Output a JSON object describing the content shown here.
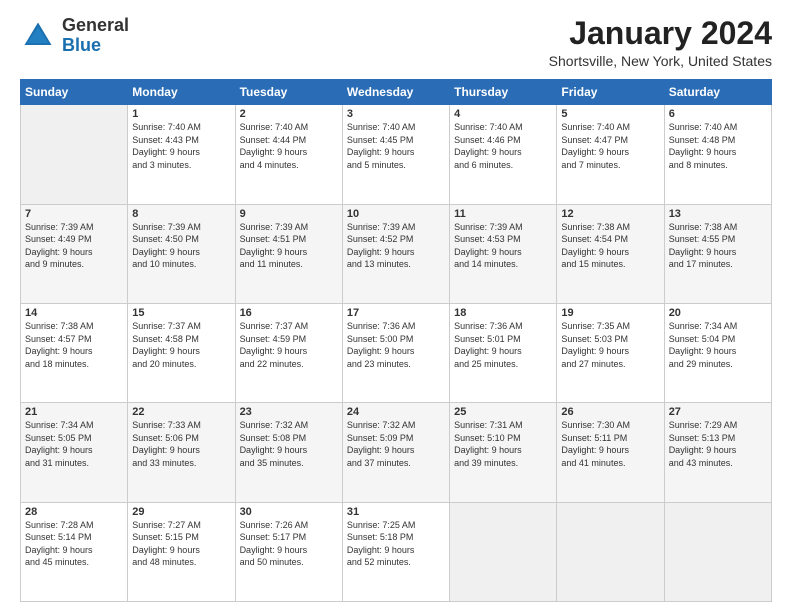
{
  "logo": {
    "line1": "General",
    "line2": "Blue"
  },
  "title": "January 2024",
  "subtitle": "Shortsville, New York, United States",
  "days_header": [
    "Sunday",
    "Monday",
    "Tuesday",
    "Wednesday",
    "Thursday",
    "Friday",
    "Saturday"
  ],
  "weeks": [
    [
      {
        "day": "",
        "info": ""
      },
      {
        "day": "1",
        "info": "Sunrise: 7:40 AM\nSunset: 4:43 PM\nDaylight: 9 hours\nand 3 minutes."
      },
      {
        "day": "2",
        "info": "Sunrise: 7:40 AM\nSunset: 4:44 PM\nDaylight: 9 hours\nand 4 minutes."
      },
      {
        "day": "3",
        "info": "Sunrise: 7:40 AM\nSunset: 4:45 PM\nDaylight: 9 hours\nand 5 minutes."
      },
      {
        "day": "4",
        "info": "Sunrise: 7:40 AM\nSunset: 4:46 PM\nDaylight: 9 hours\nand 6 minutes."
      },
      {
        "day": "5",
        "info": "Sunrise: 7:40 AM\nSunset: 4:47 PM\nDaylight: 9 hours\nand 7 minutes."
      },
      {
        "day": "6",
        "info": "Sunrise: 7:40 AM\nSunset: 4:48 PM\nDaylight: 9 hours\nand 8 minutes."
      }
    ],
    [
      {
        "day": "7",
        "info": "Sunrise: 7:39 AM\nSunset: 4:49 PM\nDaylight: 9 hours\nand 9 minutes."
      },
      {
        "day": "8",
        "info": "Sunrise: 7:39 AM\nSunset: 4:50 PM\nDaylight: 9 hours\nand 10 minutes."
      },
      {
        "day": "9",
        "info": "Sunrise: 7:39 AM\nSunset: 4:51 PM\nDaylight: 9 hours\nand 11 minutes."
      },
      {
        "day": "10",
        "info": "Sunrise: 7:39 AM\nSunset: 4:52 PM\nDaylight: 9 hours\nand 13 minutes."
      },
      {
        "day": "11",
        "info": "Sunrise: 7:39 AM\nSunset: 4:53 PM\nDaylight: 9 hours\nand 14 minutes."
      },
      {
        "day": "12",
        "info": "Sunrise: 7:38 AM\nSunset: 4:54 PM\nDaylight: 9 hours\nand 15 minutes."
      },
      {
        "day": "13",
        "info": "Sunrise: 7:38 AM\nSunset: 4:55 PM\nDaylight: 9 hours\nand 17 minutes."
      }
    ],
    [
      {
        "day": "14",
        "info": "Sunrise: 7:38 AM\nSunset: 4:57 PM\nDaylight: 9 hours\nand 18 minutes."
      },
      {
        "day": "15",
        "info": "Sunrise: 7:37 AM\nSunset: 4:58 PM\nDaylight: 9 hours\nand 20 minutes."
      },
      {
        "day": "16",
        "info": "Sunrise: 7:37 AM\nSunset: 4:59 PM\nDaylight: 9 hours\nand 22 minutes."
      },
      {
        "day": "17",
        "info": "Sunrise: 7:36 AM\nSunset: 5:00 PM\nDaylight: 9 hours\nand 23 minutes."
      },
      {
        "day": "18",
        "info": "Sunrise: 7:36 AM\nSunset: 5:01 PM\nDaylight: 9 hours\nand 25 minutes."
      },
      {
        "day": "19",
        "info": "Sunrise: 7:35 AM\nSunset: 5:03 PM\nDaylight: 9 hours\nand 27 minutes."
      },
      {
        "day": "20",
        "info": "Sunrise: 7:34 AM\nSunset: 5:04 PM\nDaylight: 9 hours\nand 29 minutes."
      }
    ],
    [
      {
        "day": "21",
        "info": "Sunrise: 7:34 AM\nSunset: 5:05 PM\nDaylight: 9 hours\nand 31 minutes."
      },
      {
        "day": "22",
        "info": "Sunrise: 7:33 AM\nSunset: 5:06 PM\nDaylight: 9 hours\nand 33 minutes."
      },
      {
        "day": "23",
        "info": "Sunrise: 7:32 AM\nSunset: 5:08 PM\nDaylight: 9 hours\nand 35 minutes."
      },
      {
        "day": "24",
        "info": "Sunrise: 7:32 AM\nSunset: 5:09 PM\nDaylight: 9 hours\nand 37 minutes."
      },
      {
        "day": "25",
        "info": "Sunrise: 7:31 AM\nSunset: 5:10 PM\nDaylight: 9 hours\nand 39 minutes."
      },
      {
        "day": "26",
        "info": "Sunrise: 7:30 AM\nSunset: 5:11 PM\nDaylight: 9 hours\nand 41 minutes."
      },
      {
        "day": "27",
        "info": "Sunrise: 7:29 AM\nSunset: 5:13 PM\nDaylight: 9 hours\nand 43 minutes."
      }
    ],
    [
      {
        "day": "28",
        "info": "Sunrise: 7:28 AM\nSunset: 5:14 PM\nDaylight: 9 hours\nand 45 minutes."
      },
      {
        "day": "29",
        "info": "Sunrise: 7:27 AM\nSunset: 5:15 PM\nDaylight: 9 hours\nand 48 minutes."
      },
      {
        "day": "30",
        "info": "Sunrise: 7:26 AM\nSunset: 5:17 PM\nDaylight: 9 hours\nand 50 minutes."
      },
      {
        "day": "31",
        "info": "Sunrise: 7:25 AM\nSunset: 5:18 PM\nDaylight: 9 hours\nand 52 minutes."
      },
      {
        "day": "",
        "info": ""
      },
      {
        "day": "",
        "info": ""
      },
      {
        "day": "",
        "info": ""
      }
    ]
  ]
}
